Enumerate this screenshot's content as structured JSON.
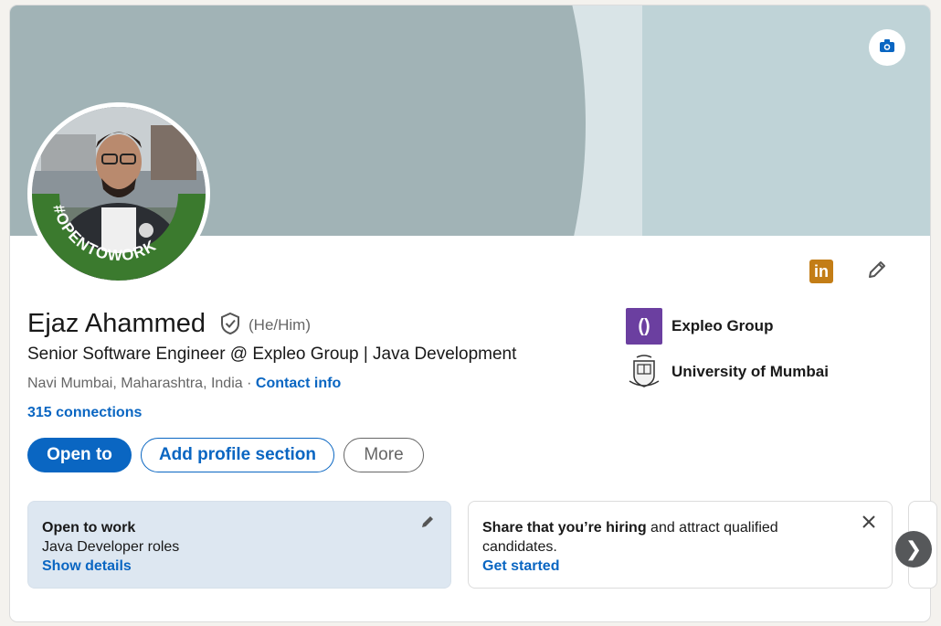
{
  "profile": {
    "name": "Ejaz Ahammed",
    "pronouns": "(He/Him)",
    "headline": "Senior Software Engineer @ Expleo Group | Java Development",
    "location": "Navi Mumbai, Maharashtra, India",
    "location_separator": "·",
    "contact_label": "Contact info",
    "connections": "315 connections",
    "avatar_frame_text": "#OPENTOWORK"
  },
  "header_icons": {
    "camera": "camera-icon",
    "linkedin_badge": "in",
    "edit": "pencil-icon"
  },
  "actions": {
    "open_to": "Open to",
    "add_section": "Add profile section",
    "more": "More"
  },
  "organizations": [
    {
      "name": "Expleo Group",
      "logo": "()"
    },
    {
      "name": "University of Mumbai",
      "logo": "university-crest"
    }
  ],
  "panels": {
    "open_to_work": {
      "title": "Open to work",
      "subtitle": "Java Developer roles",
      "link": "Show details"
    },
    "hiring": {
      "title_bold": "Share that you’re hiring",
      "title_rest": " and attract qualified candidates.",
      "link": "Get started"
    },
    "carousel_next": "❯"
  },
  "colors": {
    "brand_blue": "#0a66c2",
    "banner_dark": "#a1b3b6",
    "banner_light": "#bfd3d7",
    "otw_green": "#3b7a2e",
    "expleo_purple": "#6b3fa0",
    "linkedin_badge": "#c37d16"
  }
}
